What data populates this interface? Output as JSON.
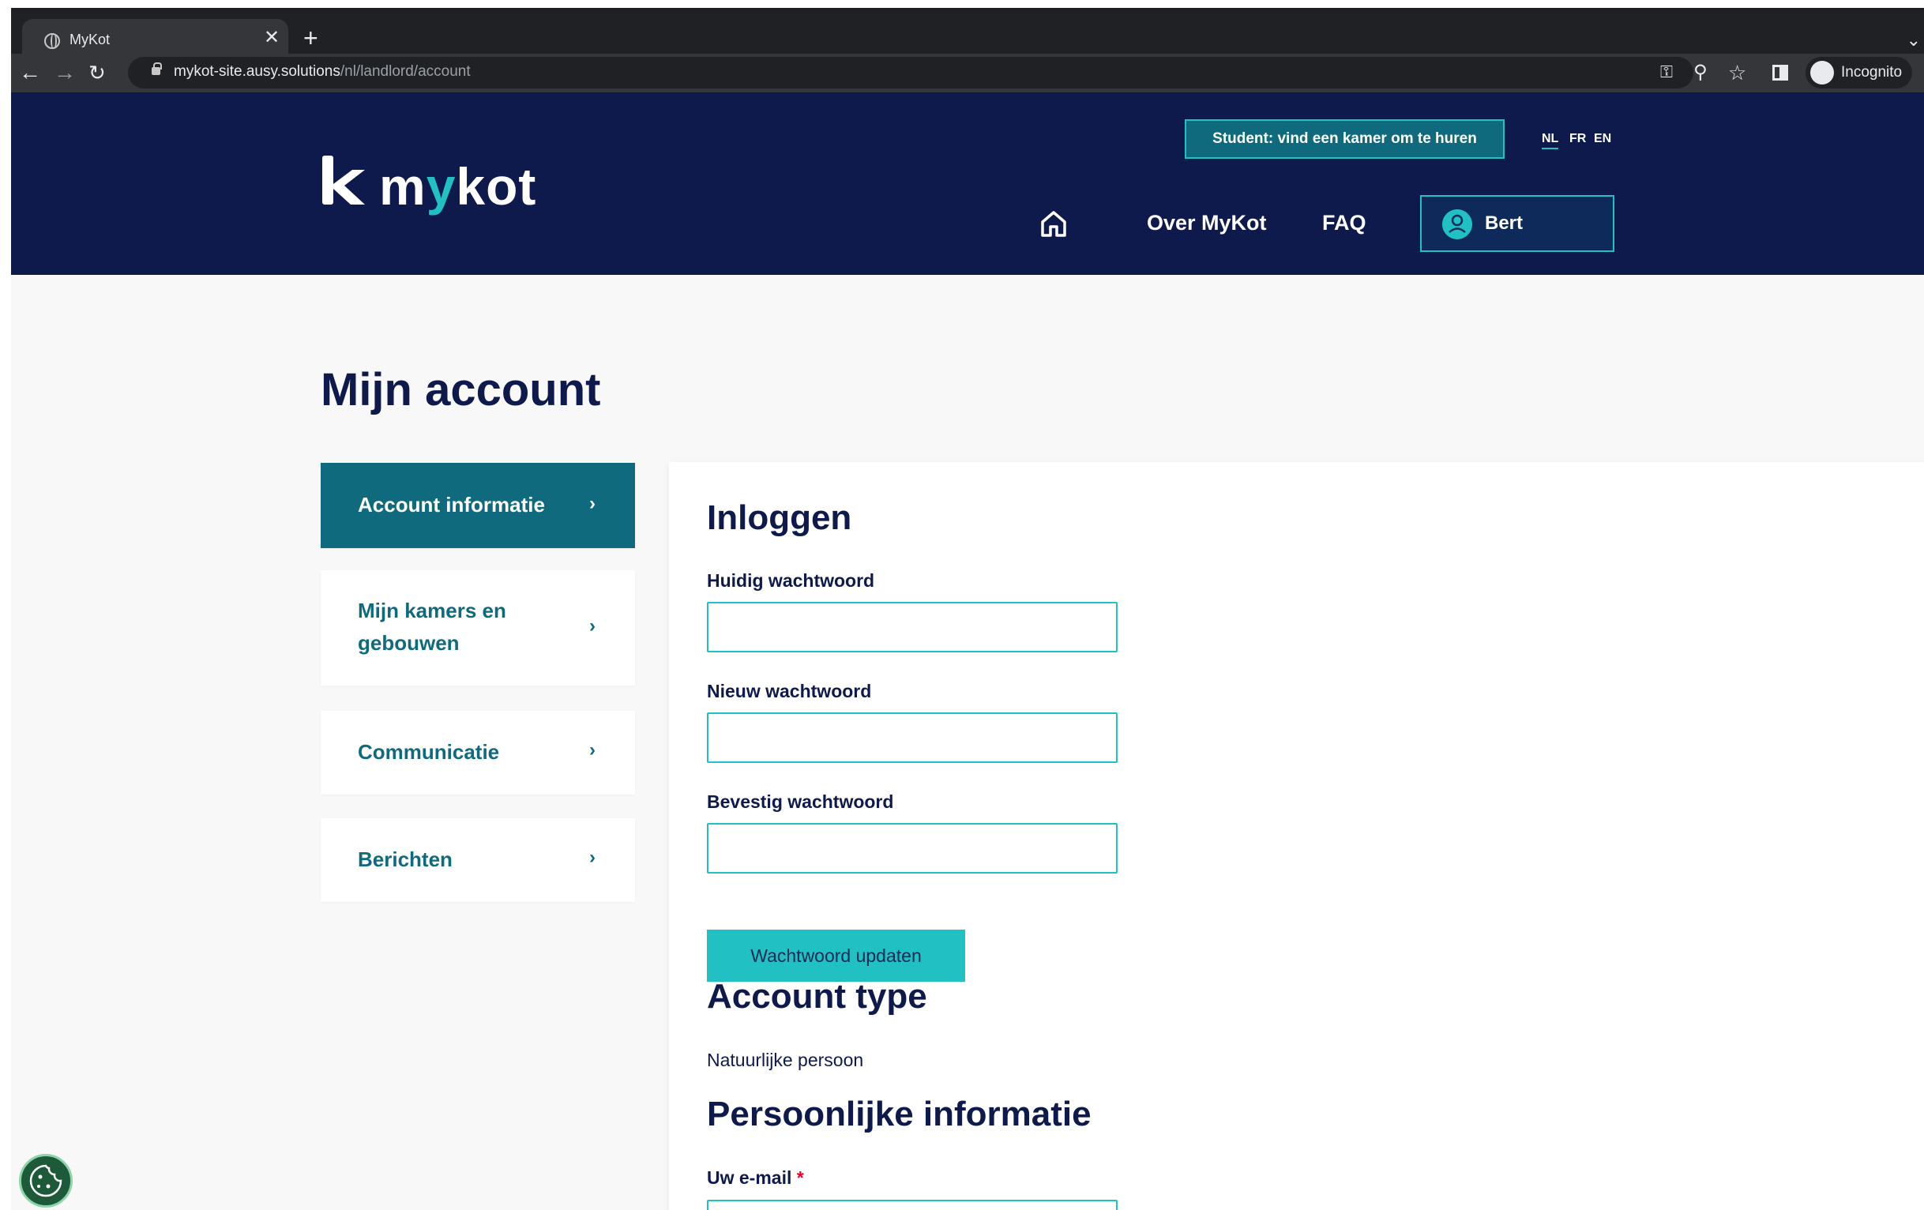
{
  "browser": {
    "tab_title": "MyKot",
    "tab_close": "✕",
    "new_tab": "+",
    "url_host": "mykot-site.ausy.solutions",
    "url_path": "/nl/landlord/account",
    "profile_label": "Incognito",
    "icons": [
      "back-icon",
      "forward-icon",
      "reload-icon",
      "key-icon",
      "zoom-icon",
      "star-icon",
      "side-panel-icon",
      "incognito-icon",
      "menu-icon"
    ]
  },
  "header": {
    "logo_text_pre": "m",
    "logo_text_y": "y",
    "logo_text_post": "kot",
    "student_button": "Student: vind een kamer om te huren",
    "languages": [
      "NL",
      "FR",
      "EN"
    ],
    "active_language": "NL",
    "nav": {
      "about": "Over MyKot",
      "faq": "FAQ"
    },
    "user_name": "Bert"
  },
  "page": {
    "title": "Mijn account",
    "sidebar": [
      {
        "label": "Account informatie",
        "active": true
      },
      {
        "label_line1": "Mijn kamers en",
        "label_line2": "gebouwen",
        "active": false
      },
      {
        "label": "Communicatie",
        "active": false
      },
      {
        "label": "Berichten",
        "active": false
      }
    ],
    "chevron": "›",
    "login": {
      "heading": "Inloggen",
      "current_password_label": "Huidig wachtwoord",
      "new_password_label": "Nieuw wachtwoord",
      "confirm_password_label": "Bevestig wachtwoord",
      "current_password_value": "",
      "new_password_value": "",
      "confirm_password_value": "",
      "update_button": "Wachtwoord updaten"
    },
    "account_type": {
      "heading": "Account type",
      "value": "Natuurlijke persoon"
    },
    "personal_info": {
      "heading": "Persoonlijke informatie",
      "email_label": "Uw e-mail",
      "required_mark": "*"
    }
  },
  "colors": {
    "navy": "#0d1a4b",
    "teal": "#106a7e",
    "accent": "#21c0c3",
    "required": "#e4002b"
  }
}
